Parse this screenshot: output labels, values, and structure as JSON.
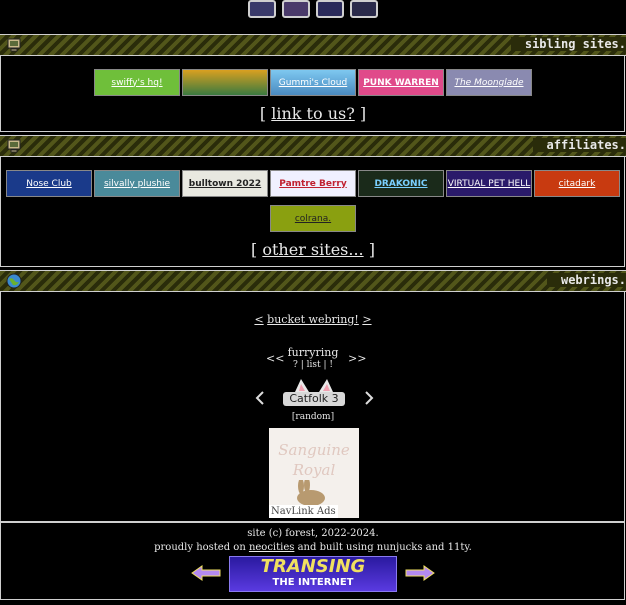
{
  "sibling_sites": {
    "title": "sibling sites.",
    "buttons": [
      "swiffy's hq!",
      "",
      "Gummi's Cloud",
      "PUNK WARREN",
      "The Moonglade"
    ],
    "link_prefix": "[",
    "link": "link to us?",
    "link_suffix": "]"
  },
  "affiliates": {
    "title": "affiliates.",
    "buttons": [
      "Nose Club",
      "silvally plushie",
      "bulltown 2022",
      "Pamtre Berry",
      "DRAKONIC",
      "VIRTUAL PET HELL",
      "citadark",
      "colrana."
    ],
    "link_prefix": "[",
    "link": "other sites...",
    "link_suffix": "]"
  },
  "webrings": {
    "title": "webrings.",
    "bucket_prev": "<",
    "bucket_label": "bucket webring!",
    "bucket_next": ">",
    "furry_prev": "<<",
    "furry_name": "furryring",
    "furry_links": "? | list | !",
    "furry_next": ">>",
    "catfolk_label": "Catfolk 3",
    "random": "[random]",
    "ad_title": "Sanguine Royal",
    "ad_caption": "NavLink Ads"
  },
  "footer": {
    "line1": "site (c) forest, 2022-2024.",
    "line2_prefix": "proudly hosted on",
    "line2_link": "neocities",
    "line2_suffix": "and built using nunjucks and 11ty.",
    "banner_top": "TRANSING",
    "banner_bottom": "THE INTERNET"
  }
}
